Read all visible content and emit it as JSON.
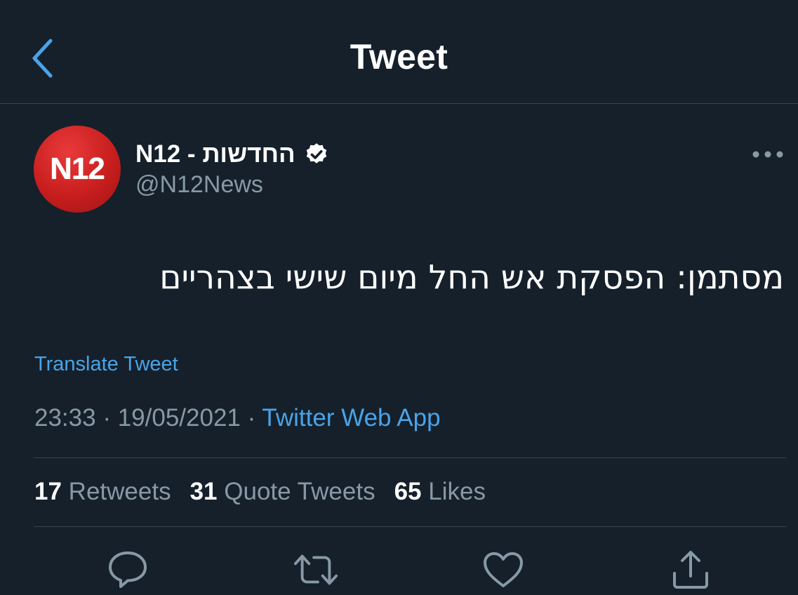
{
  "header": {
    "title": "Tweet",
    "back_icon": "chevron-left-icon"
  },
  "author": {
    "avatar_text": "N12",
    "display_name": "N12 - החדשות",
    "verified": true,
    "handle": "@N12News"
  },
  "tweet": {
    "text": "מסתמן: הפסקת אש החל מיום שישי בצהריים",
    "translate_label": "Translate Tweet"
  },
  "meta": {
    "time": "23:33",
    "separator": "·",
    "date": "19/05/2021",
    "source": "Twitter Web App"
  },
  "stats": {
    "retweets_count": "17",
    "retweets_label": "Retweets",
    "quotes_count": "31",
    "quotes_label": "Quote Tweets",
    "likes_count": "65",
    "likes_label": "Likes"
  },
  "actions": [
    "reply-icon",
    "retweet-icon",
    "like-icon",
    "share-icon"
  ],
  "colors": {
    "background": "#15202b",
    "accent": "#4aa3e8",
    "secondary_text": "#8899a6",
    "divider": "#38444d",
    "avatar_red": "#c81e1e"
  }
}
